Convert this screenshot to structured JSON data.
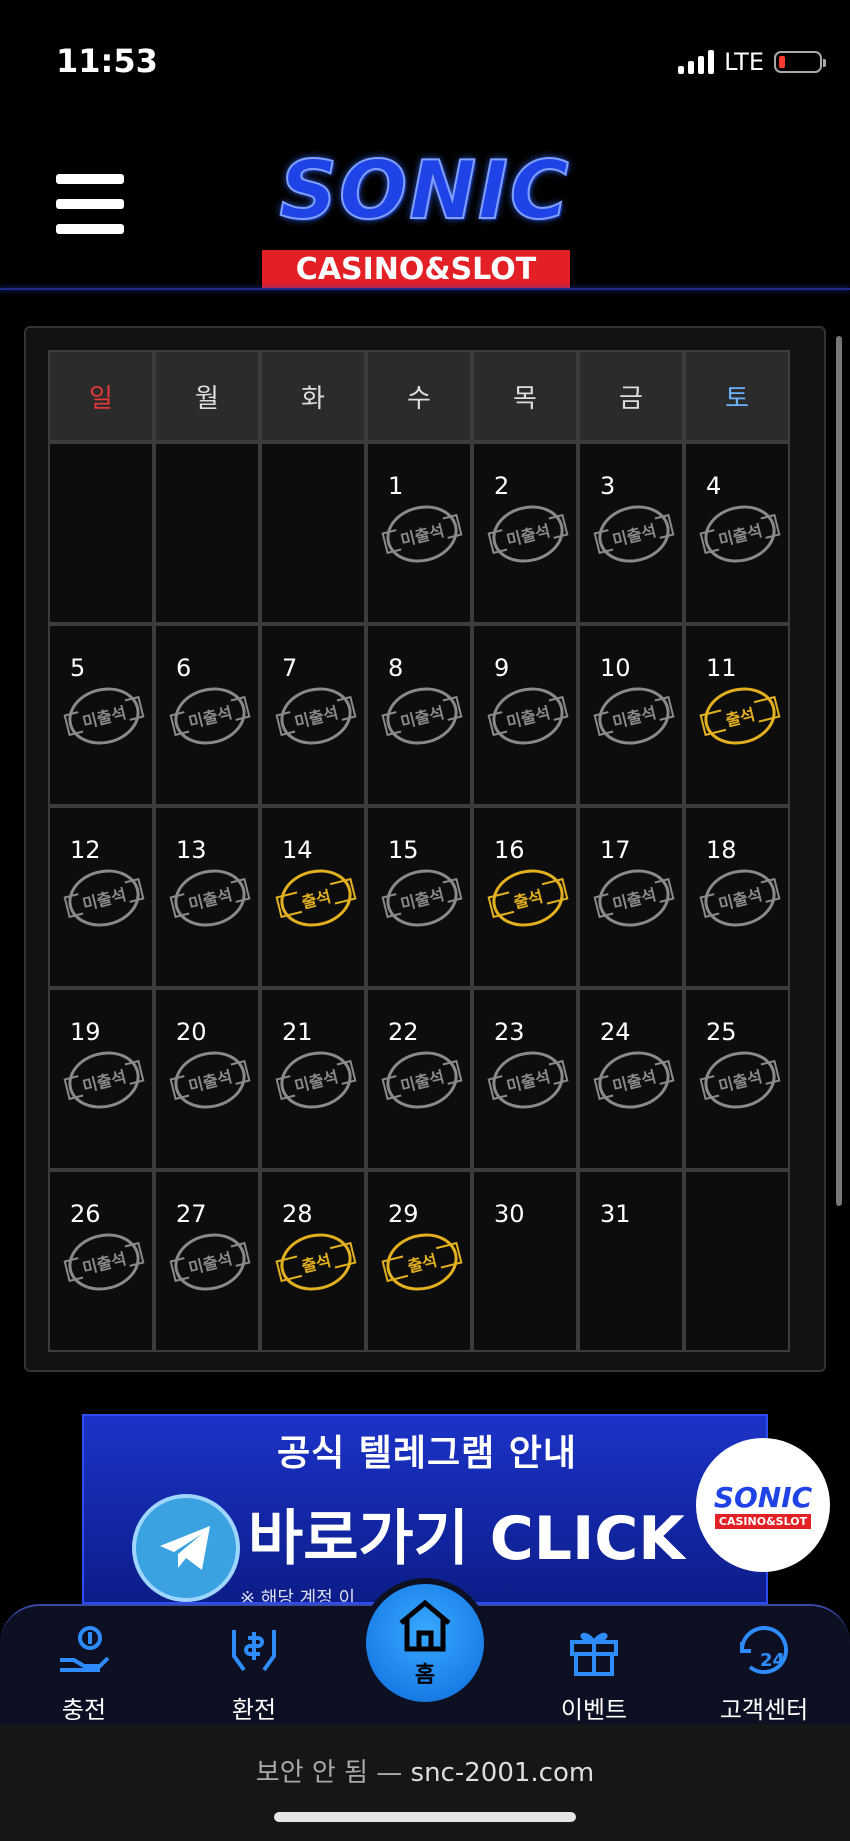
{
  "status": {
    "time": "11:53",
    "network": "LTE"
  },
  "header": {
    "logo_word": "SONIC",
    "logo_sub": "CASINO&SLOT"
  },
  "calendar": {
    "weekdays": [
      "일",
      "월",
      "화",
      "수",
      "목",
      "금",
      "토"
    ],
    "stamp_absent": "미출석",
    "stamp_present": "출석",
    "days": [
      {
        "day": "",
        "status": ""
      },
      {
        "day": "",
        "status": ""
      },
      {
        "day": "",
        "status": ""
      },
      {
        "day": "1",
        "status": "absent"
      },
      {
        "day": "2",
        "status": "absent"
      },
      {
        "day": "3",
        "status": "absent"
      },
      {
        "day": "4",
        "status": "absent"
      },
      {
        "day": "5",
        "status": "absent"
      },
      {
        "day": "6",
        "status": "absent"
      },
      {
        "day": "7",
        "status": "absent"
      },
      {
        "day": "8",
        "status": "absent"
      },
      {
        "day": "9",
        "status": "absent"
      },
      {
        "day": "10",
        "status": "absent"
      },
      {
        "day": "11",
        "status": "present"
      },
      {
        "day": "12",
        "status": "absent"
      },
      {
        "day": "13",
        "status": "absent"
      },
      {
        "day": "14",
        "status": "present"
      },
      {
        "day": "15",
        "status": "absent"
      },
      {
        "day": "16",
        "status": "present"
      },
      {
        "day": "17",
        "status": "absent"
      },
      {
        "day": "18",
        "status": "absent"
      },
      {
        "day": "19",
        "status": "absent"
      },
      {
        "day": "20",
        "status": "absent"
      },
      {
        "day": "21",
        "status": "absent"
      },
      {
        "day": "22",
        "status": "absent"
      },
      {
        "day": "23",
        "status": "absent"
      },
      {
        "day": "24",
        "status": "absent"
      },
      {
        "day": "25",
        "status": "absent"
      },
      {
        "day": "26",
        "status": "absent"
      },
      {
        "day": "27",
        "status": "absent"
      },
      {
        "day": "28",
        "status": "present"
      },
      {
        "day": "29",
        "status": "present"
      },
      {
        "day": "30",
        "status": ""
      },
      {
        "day": "31",
        "status": ""
      },
      {
        "day": "",
        "status": ""
      }
    ]
  },
  "banner": {
    "title": "공식 텔레그램 안내",
    "cta": "바로가기 CLICK",
    "note": "※ 해당 계정 이"
  },
  "float_logo": {
    "word": "SONIC",
    "sub": "CASINO&SLOT"
  },
  "nav": {
    "deposit": "충전",
    "withdraw": "환전",
    "home": "홈",
    "event": "이벤트",
    "support": "고객센터"
  },
  "urlbar": {
    "insecure": "보안 안 됨 —",
    "url": "snc-2001.com"
  }
}
